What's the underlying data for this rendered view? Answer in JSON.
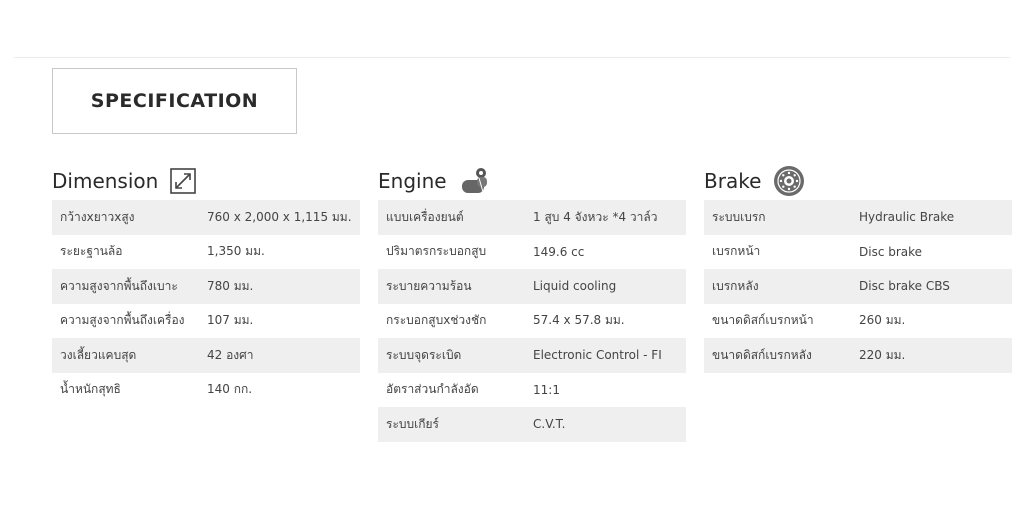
{
  "header": {
    "tab_label": "SPECIFICATION"
  },
  "sections": [
    {
      "title": "Dimension",
      "icon": "resize-arrow-icon",
      "rows": [
        {
          "label": "กว้างxยาวxสูง",
          "value": "760 x 2,000 x 1,115 มม."
        },
        {
          "label": "ระยะฐานล้อ",
          "value": "1,350 มม."
        },
        {
          "label": "ความสูงจากพื้นถึงเบาะ",
          "value": "780 มม."
        },
        {
          "label": "ความสูงจากพื้นถึงเครื่อง",
          "value": "107 มม."
        },
        {
          "label": "วงเลี้ยวแคบสุด",
          "value": "42 องศา"
        },
        {
          "label": "น้ำหนักสุทธิ",
          "value": "140 กก."
        }
      ]
    },
    {
      "title": "Engine",
      "icon": "engine-piston-icon",
      "rows": [
        {
          "label": "แบบเครื่องยนต์",
          "value": "1 สูบ 4 จังหวะ *4 วาล์ว"
        },
        {
          "label": "ปริมาตรกระบอกสูบ",
          "value": "149.6 cc"
        },
        {
          "label": "ระบายความร้อน",
          "value": "Liquid cooling"
        },
        {
          "label": "กระบอกสูบxช่วงชัก",
          "value": "57.4 x 57.8 มม."
        },
        {
          "label": "ระบบจุดระเบิด",
          "value": "Electronic Control - FI"
        },
        {
          "label": "อัตราส่วนกำลังอัด",
          "value": "11:1"
        },
        {
          "label": "ระบบเกียร์",
          "value": "C.V.T."
        }
      ]
    },
    {
      "title": "Brake",
      "icon": "brake-disc-icon",
      "rows": [
        {
          "label": "ระบบเบรก",
          "value": "Hydraulic Brake"
        },
        {
          "label": "เบรกหน้า",
          "value": "Disc brake"
        },
        {
          "label": "เบรกหลัง",
          "value": "Disc brake CBS"
        },
        {
          "label": "ขนาดดิสก์เบรกหน้า",
          "value": "260 มม."
        },
        {
          "label": "ขนาดดิสก์เบรกหลัง",
          "value": "220 มม."
        }
      ]
    }
  ]
}
